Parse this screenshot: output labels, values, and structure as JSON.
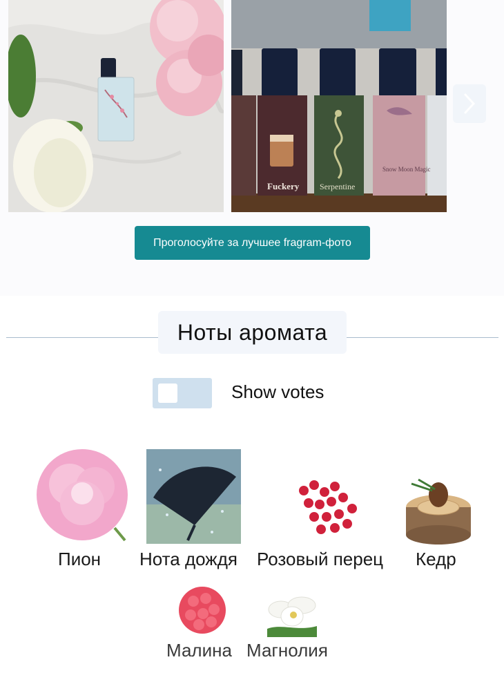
{
  "gallery": {
    "photos": [
      {
        "alt": "perfume bottle with peonies"
      },
      {
        "alt": "perfume bottles row"
      }
    ],
    "bottle_labels": [
      "Fuckery",
      "Serpentine",
      "Snow Moon Magic"
    ]
  },
  "vote_button": {
    "label": "Проголосуйте за лучшее fragram-фото"
  },
  "notes": {
    "title": "Ноты аромата",
    "toggle_label": "Show votes",
    "toggle_on": false,
    "items": [
      {
        "label": "Пион",
        "icon": "peony-icon"
      },
      {
        "label": "Нота дождя",
        "icon": "rain-umbrella-icon"
      },
      {
        "label": "Розовый перец",
        "icon": "pink-pepper-icon"
      },
      {
        "label": "Кедр",
        "icon": "cedar-icon"
      },
      {
        "label": "Малина",
        "icon": "raspberry-icon"
      },
      {
        "label": "Магнолия",
        "icon": "magnolia-icon"
      }
    ]
  },
  "colors": {
    "accent": "#168a92",
    "divider": "#a9bccd",
    "toggle_bg": "#cfe0ee"
  }
}
